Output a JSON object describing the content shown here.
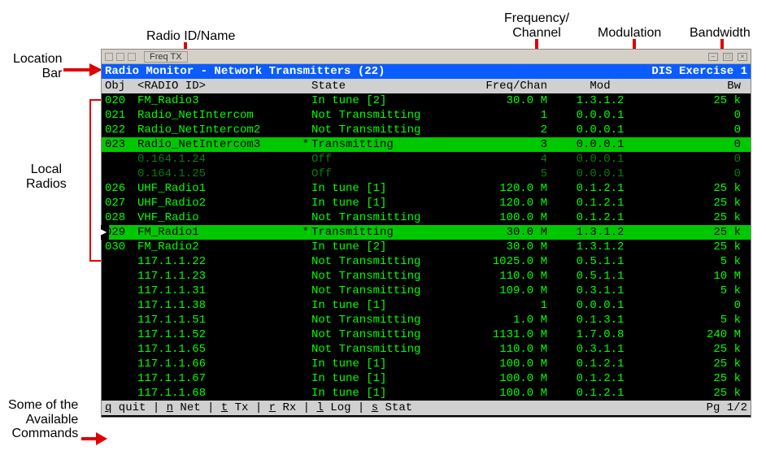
{
  "annotations": {
    "radio_id": "Radio ID/Name",
    "freq": "Frequency/\nChannel",
    "mod": "Modulation",
    "bw": "Bandwidth",
    "location_bar": "Location\nBar",
    "local_radios": "Local\nRadios",
    "commands": "Some of the\nAvailable\nCommands"
  },
  "toolbar": {
    "tab": "Freq TX"
  },
  "locbar": {
    "title": "Radio Monitor - Network Transmitters (22)",
    "exercise": "DIS Exercise 1"
  },
  "columns": {
    "obj": "Obj",
    "id": "<RADIO ID>",
    "state": "State",
    "freq": "Freq/Chan",
    "mod": "Mod",
    "bw": "Bw"
  },
  "rows": [
    {
      "obj": "020",
      "id": "FM_Radio3",
      "star": "",
      "state": "In tune [2]",
      "freq": "30.0 M",
      "mod": "1.3.1.2",
      "bw": "25 k",
      "cls": ""
    },
    {
      "obj": "021",
      "id": "Radio_NetIntercom",
      "star": "",
      "state": "Not Transmitting",
      "freq": "1",
      "mod": "0.0.0.1",
      "bw": "0",
      "cls": ""
    },
    {
      "obj": "022",
      "id": "Radio_NetIntercom2",
      "star": "",
      "state": "Not Transmitting",
      "freq": "2",
      "mod": "0.0.0.1",
      "bw": "0",
      "cls": ""
    },
    {
      "obj": "023",
      "id": "Radio_NetIntercom3",
      "star": "*",
      "state": "Transmitting",
      "freq": "3",
      "mod": "0.0.0.1",
      "bw": "0",
      "cls": "hl"
    },
    {
      "obj": "",
      "id": "0.164.1.24",
      "star": "",
      "state": "Off",
      "freq": "4",
      "mod": "0.0.0.1",
      "bw": "0",
      "cls": "dim"
    },
    {
      "obj": "",
      "id": "0.164.1.25",
      "star": "",
      "state": "Off",
      "freq": "5",
      "mod": "0.0.0.1",
      "bw": "0",
      "cls": "dim"
    },
    {
      "obj": "026",
      "id": "UHF_Radio1",
      "star": "",
      "state": "In tune [1]",
      "freq": "120.0 M",
      "mod": "0.1.2.1",
      "bw": "25 k",
      "cls": ""
    },
    {
      "obj": "027",
      "id": "UHF_Radio2",
      "star": "",
      "state": "In tune [1]",
      "freq": "120.0 M",
      "mod": "0.1.2.1",
      "bw": "25 k",
      "cls": ""
    },
    {
      "obj": "028",
      "id": "VHF_Radio",
      "star": "",
      "state": "Not Transmitting",
      "freq": "100.0 M",
      "mod": "0.1.2.1",
      "bw": "25 k",
      "cls": ""
    },
    {
      "obj": "029",
      "id": "FM_Radio1",
      "star": "*",
      "state": "Transmitting",
      "freq": "30.0 M",
      "mod": "1.3.1.2",
      "bw": "25 k",
      "cls": "hl cursor"
    },
    {
      "obj": "030",
      "id": "FM_Radio2",
      "star": "",
      "state": "In tune [2]",
      "freq": "30.0 M",
      "mod": "1.3.1.2",
      "bw": "25 k",
      "cls": ""
    },
    {
      "obj": "",
      "id": "117.1.1.22",
      "star": "",
      "state": "Not Transmitting",
      "freq": "1025.0 M",
      "mod": "0.5.1.1",
      "bw": "5 k",
      "cls": ""
    },
    {
      "obj": "",
      "id": "117.1.1.23",
      "star": "",
      "state": "Not Transmitting",
      "freq": "110.0 M",
      "mod": "0.5.1.1",
      "bw": "10 M",
      "cls": ""
    },
    {
      "obj": "",
      "id": "117.1.1.31",
      "star": "",
      "state": "Not Transmitting",
      "freq": "109.0 M",
      "mod": "0.3.1.1",
      "bw": "5 k",
      "cls": ""
    },
    {
      "obj": "",
      "id": "117.1.1.38",
      "star": "",
      "state": "In tune [1]",
      "freq": "1",
      "mod": "0.0.0.1",
      "bw": "0",
      "cls": ""
    },
    {
      "obj": "",
      "id": "117.1.1.51",
      "star": "",
      "state": "Not Transmitting",
      "freq": "1.0 M",
      "mod": "0.1.3.1",
      "bw": "5 k",
      "cls": ""
    },
    {
      "obj": "",
      "id": "117.1.1.52",
      "star": "",
      "state": "Not Transmitting",
      "freq": "1131.0 M",
      "mod": "1.7.0.8",
      "bw": "240 M",
      "cls": ""
    },
    {
      "obj": "",
      "id": "117.1.1.65",
      "star": "",
      "state": "Not Transmitting",
      "freq": "110.0 M",
      "mod": "0.3.1.1",
      "bw": "25 k",
      "cls": ""
    },
    {
      "obj": "",
      "id": "117.1.1.66",
      "star": "",
      "state": "In tune [1]",
      "freq": "100.0 M",
      "mod": "0.1.2.1",
      "bw": "25 k",
      "cls": ""
    },
    {
      "obj": "",
      "id": "117.1.1.67",
      "star": "",
      "state": "In tune [1]",
      "freq": "100.0 M",
      "mod": "0.1.2.1",
      "bw": "25 k",
      "cls": ""
    },
    {
      "obj": "",
      "id": "117.1.1.68",
      "star": "",
      "state": "In tune [1]",
      "freq": "100.0 M",
      "mod": "0.1.2.1",
      "bw": "25 k",
      "cls": ""
    }
  ],
  "cmdbar": {
    "text": "q quit | n Net | t Tx | r Rx | l Log | s Stat",
    "page": "Pg 1/2"
  }
}
